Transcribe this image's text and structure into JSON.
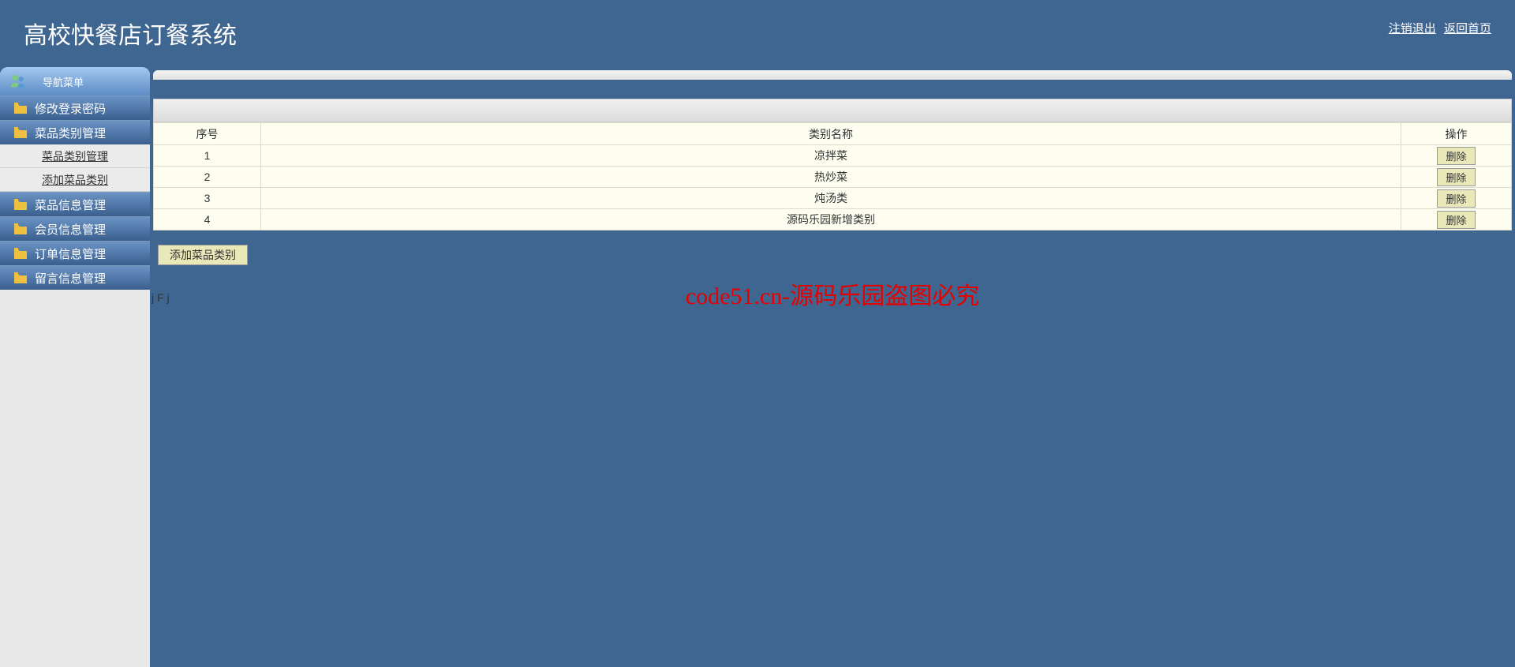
{
  "header": {
    "title": "高校快餐店订餐系统",
    "logout": "注销退出",
    "home": "返回首页"
  },
  "sidebar": {
    "nav_title": "导航菜单",
    "items": [
      {
        "label": "修改登录密码",
        "expanded": false
      },
      {
        "label": "菜品类别管理",
        "expanded": true,
        "subs": [
          "菜品类别管理",
          "添加菜品类别"
        ]
      },
      {
        "label": "菜品信息管理",
        "expanded": false
      },
      {
        "label": "会员信息管理",
        "expanded": false
      },
      {
        "label": "订单信息管理",
        "expanded": false
      },
      {
        "label": "留言信息管理",
        "expanded": false
      }
    ]
  },
  "table": {
    "headers": {
      "seq": "序号",
      "name": "类别名称",
      "ops": "操作"
    },
    "rows": [
      {
        "seq": "1",
        "name": "凉拌菜"
      },
      {
        "seq": "2",
        "name": "热炒菜"
      },
      {
        "seq": "3",
        "name": "炖汤类"
      },
      {
        "seq": "4",
        "name": "源码乐园新增类别"
      }
    ],
    "delete_label": "删除"
  },
  "buttons": {
    "add_category": "添加菜品类别"
  },
  "watermark": "code51.cn-源码乐园盗图必究",
  "stray_chars": "j\nF\nj"
}
